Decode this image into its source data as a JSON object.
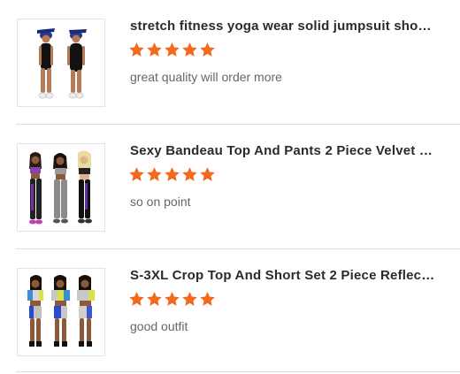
{
  "colors": {
    "star": "#f36a1e",
    "title": "#2b2b2b",
    "comment": "#666666",
    "divider": "#dcdcdc"
  },
  "reviews": [
    {
      "title": "stretch fitness yoga wear solid jumpsuit short ...",
      "rating": 5,
      "comment": "great quality will order more",
      "image_icon": "product-photo-black-jumpsuit"
    },
    {
      "title": "Sexy Bandeau Top And Pants 2 Piece Velvet W...",
      "rating": 5,
      "comment": "so on point",
      "image_icon": "product-photo-velvet-sets"
    },
    {
      "title": "S-3XL Crop Top And Short Set 2 Piece Reflectiv...",
      "rating": 5,
      "comment": "good outfit",
      "image_icon": "product-photo-reflective-sets"
    }
  ]
}
